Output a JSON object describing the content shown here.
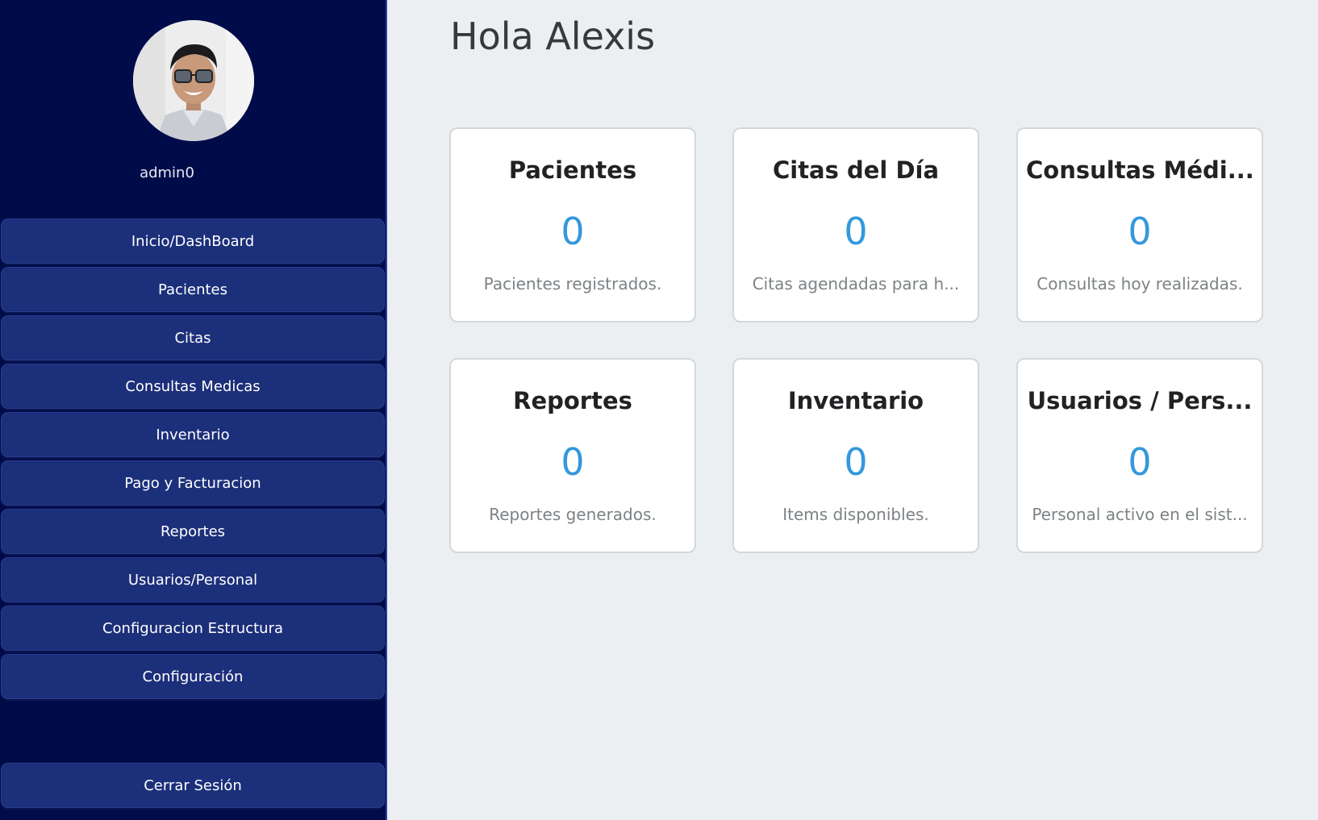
{
  "sidebar": {
    "username": "admin0",
    "nav_items": [
      {
        "label": "Inicio/DashBoard"
      },
      {
        "label": "Pacientes"
      },
      {
        "label": "Citas"
      },
      {
        "label": "Consultas Medicas"
      },
      {
        "label": "Inventario"
      },
      {
        "label": "Pago y Facturacion"
      },
      {
        "label": "Reportes"
      },
      {
        "label": "Usuarios/Personal"
      },
      {
        "label": "Configuracion Estructura"
      },
      {
        "label": "Configuración"
      }
    ],
    "logout_label": "Cerrar Sesión"
  },
  "main": {
    "greeting": "Hola Alexis",
    "cards": [
      {
        "title": "Pacientes",
        "value": "0",
        "description": "Pacientes registrados."
      },
      {
        "title": "Citas del Día",
        "value": "0",
        "description": "Citas agendadas para h..."
      },
      {
        "title": "Consultas Médi...",
        "value": "0",
        "description": "Consultas hoy realizadas."
      },
      {
        "title": "Reportes",
        "value": "0",
        "description": "Reportes generados."
      },
      {
        "title": "Inventario",
        "value": "0",
        "description": "Items disponibles."
      },
      {
        "title": "Usuarios / Pers...",
        "value": "0",
        "description": "Personal activo en el sist..."
      }
    ]
  },
  "colors": {
    "sidebar_bg": "#000C4A",
    "nav_button_bg": "#1C2F7A",
    "main_bg": "#ECEFF1",
    "card_value": "#3598DB",
    "card_title": "#202224",
    "card_desc": "#7D8285"
  }
}
